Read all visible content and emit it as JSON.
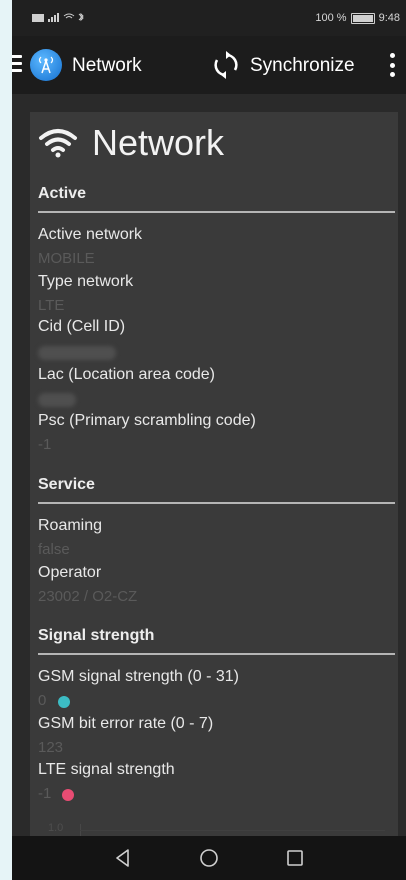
{
  "status_bar": {
    "battery_text": "100 %",
    "time": "9:48"
  },
  "appbar": {
    "title": "Network",
    "sync_label": "Synchronize",
    "icons": [
      "menu-icon",
      "app-logo-icon",
      "sync-icon",
      "more-vert-icon"
    ]
  },
  "page": {
    "title": "Network",
    "icon": "wifi-icon"
  },
  "sections": {
    "active": {
      "title": "Active",
      "rows": [
        {
          "label": "Active network",
          "value": "MOBILE"
        },
        {
          "label": "Type network",
          "value": "LTE"
        },
        {
          "label": "Cid (Cell ID)",
          "value": ""
        },
        {
          "label": "Lac (Location area code)",
          "value": ""
        },
        {
          "label": "Psc (Primary scrambling code)",
          "value": "-1"
        }
      ]
    },
    "service": {
      "title": "Service",
      "rows": [
        {
          "label": "Roaming",
          "value": "false"
        },
        {
          "label": "Operator",
          "value": "23002 / O2-CZ"
        }
      ]
    },
    "signal": {
      "title": "Signal strength",
      "rows": [
        {
          "label": "GSM signal strength (0 - 31)",
          "value": "0",
          "dot_color": "#3cbcc4"
        },
        {
          "label": "GSM bit error rate (0 - 7)",
          "value": "123"
        },
        {
          "label": "LTE signal strength",
          "value": "-1",
          "dot_color": "#e84c73"
        }
      ]
    }
  },
  "chart": {
    "tick_label": "1.0"
  },
  "colors": {
    "accent_teal": "#3cbcc4",
    "accent_pink": "#e84c73",
    "app_blue": "#1470d0"
  }
}
